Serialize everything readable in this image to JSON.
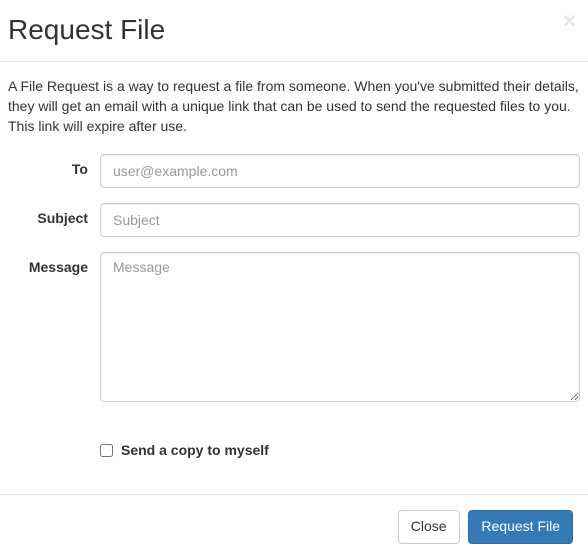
{
  "header": {
    "title": "Request File",
    "close_char": "×"
  },
  "body": {
    "description": "A File Request is a way to request a file from someone. When you've submitted their details, they will get an email with a unique link that can be used to send the requested files to you. This link will expire after use."
  },
  "form": {
    "to": {
      "label": "To",
      "placeholder": "user@example.com",
      "value": ""
    },
    "subject": {
      "label": "Subject",
      "placeholder": "Subject",
      "value": ""
    },
    "message": {
      "label": "Message",
      "placeholder": "Message",
      "value": ""
    },
    "send_copy": {
      "label": "Send a copy to myself",
      "checked": false
    }
  },
  "footer": {
    "close_label": "Close",
    "submit_label": "Request File"
  }
}
